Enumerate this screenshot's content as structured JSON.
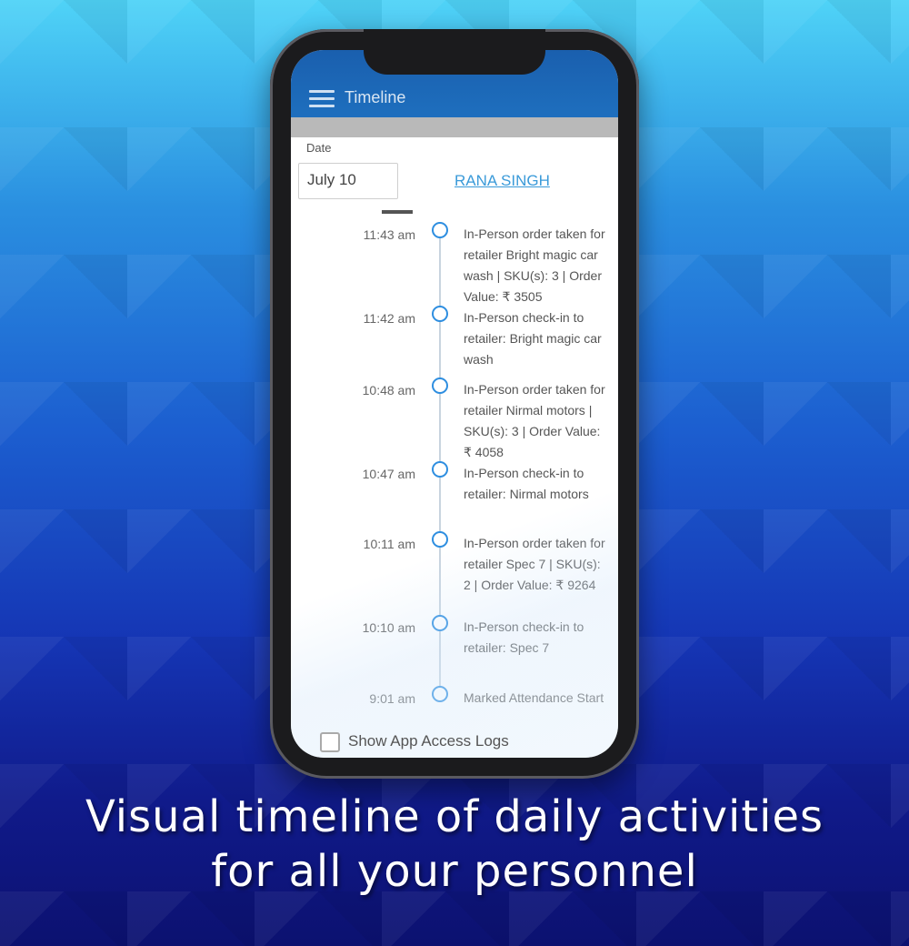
{
  "app": {
    "title": "Timeline"
  },
  "filters": {
    "date_label": "Date",
    "date_value": "July 10",
    "user_name": "RANA SINGH"
  },
  "timeline": [
    {
      "time": "11:43 am",
      "text": "In-Person order taken for retailer Bright magic car wash | SKU(s): 3 | Order Value: ₹ 3505"
    },
    {
      "time": "11:42 am",
      "text": "In-Person check-in to retailer: Bright magic car wash"
    },
    {
      "time": "10:48 am",
      "text": "In-Person order taken for retailer Nirmal motors | SKU(s): 3 | Order Value: ₹ 4058"
    },
    {
      "time": "10:47 am",
      "text": "In-Person check-in to retailer: Nirmal motors"
    },
    {
      "time": "10:11 am",
      "text": "In-Person order taken for retailer Spec 7 | SKU(s): 2 | Order Value: ₹ 9264"
    },
    {
      "time": "10:10 am",
      "text": "In-Person check-in to retailer: Spec 7"
    },
    {
      "time": "9:01 am",
      "text": "Marked Attendance Start"
    }
  ],
  "footer": {
    "checkbox_label": "Show App Access Logs",
    "checkbox_checked": false
  },
  "promo": {
    "line1": "Visual timeline of daily activities",
    "line2": "for all your personnel"
  },
  "colors": {
    "appbar": "#1e6fbe",
    "accent": "#2e8ee0",
    "link": "#3a9ad9"
  },
  "icons": {
    "menu": "hamburger-menu-icon",
    "node": "timeline-node-icon"
  }
}
